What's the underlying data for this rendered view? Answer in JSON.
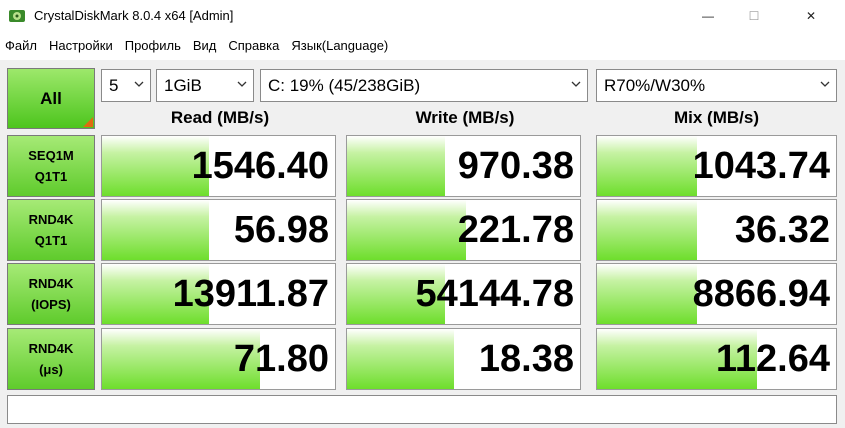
{
  "window": {
    "title": "CrystalDiskMark 8.0.4 x64 [Admin]",
    "minimize_glyph": "—",
    "maximize_glyph": "☐",
    "close_glyph": "✕"
  },
  "menu": [
    {
      "label": "Файл"
    },
    {
      "label": "Настройки"
    },
    {
      "label": "Профиль"
    },
    {
      "label": "Вид"
    },
    {
      "label": "Справка"
    },
    {
      "label": "Язык(Language)"
    }
  ],
  "controls": {
    "all_label": "All",
    "count": "5",
    "size": "1GiB",
    "drive": "C: 19% (45/238GiB)",
    "mix": "R70%/W30%"
  },
  "headers": {
    "read": "Read (MB/s)",
    "write": "Write (MB/s)",
    "mix": "Mix (MB/s)"
  },
  "rows": [
    {
      "line1": "SEQ1M",
      "line2": "Q1T1",
      "read": {
        "value": "1546.40",
        "fill": 0.46
      },
      "write": {
        "value": "970.38",
        "fill": 0.42
      },
      "mix": {
        "value": "1043.74",
        "fill": 0.42
      }
    },
    {
      "line1": "RND4K",
      "line2": "Q1T1",
      "read": {
        "value": "56.98",
        "fill": 0.46
      },
      "write": {
        "value": "221.78",
        "fill": 0.51
      },
      "mix": {
        "value": "36.32",
        "fill": 0.42
      }
    },
    {
      "line1": "RND4K",
      "line2": "(IOPS)",
      "read": {
        "value": "13911.87",
        "fill": 0.46
      },
      "write": {
        "value": "54144.78",
        "fill": 0.42
      },
      "mix": {
        "value": "8866.94",
        "fill": 0.42
      }
    },
    {
      "line1": "RND4K",
      "line2": "(μs)",
      "read": {
        "value": "71.80",
        "fill": 0.68
      },
      "write": {
        "value": "18.38",
        "fill": 0.46
      },
      "mix": {
        "value": "112.64",
        "fill": 0.67
      }
    }
  ],
  "status": {
    "text": ""
  },
  "colors": {
    "accent_green": "#6ede2c",
    "corner_orange": "#e06a10"
  }
}
